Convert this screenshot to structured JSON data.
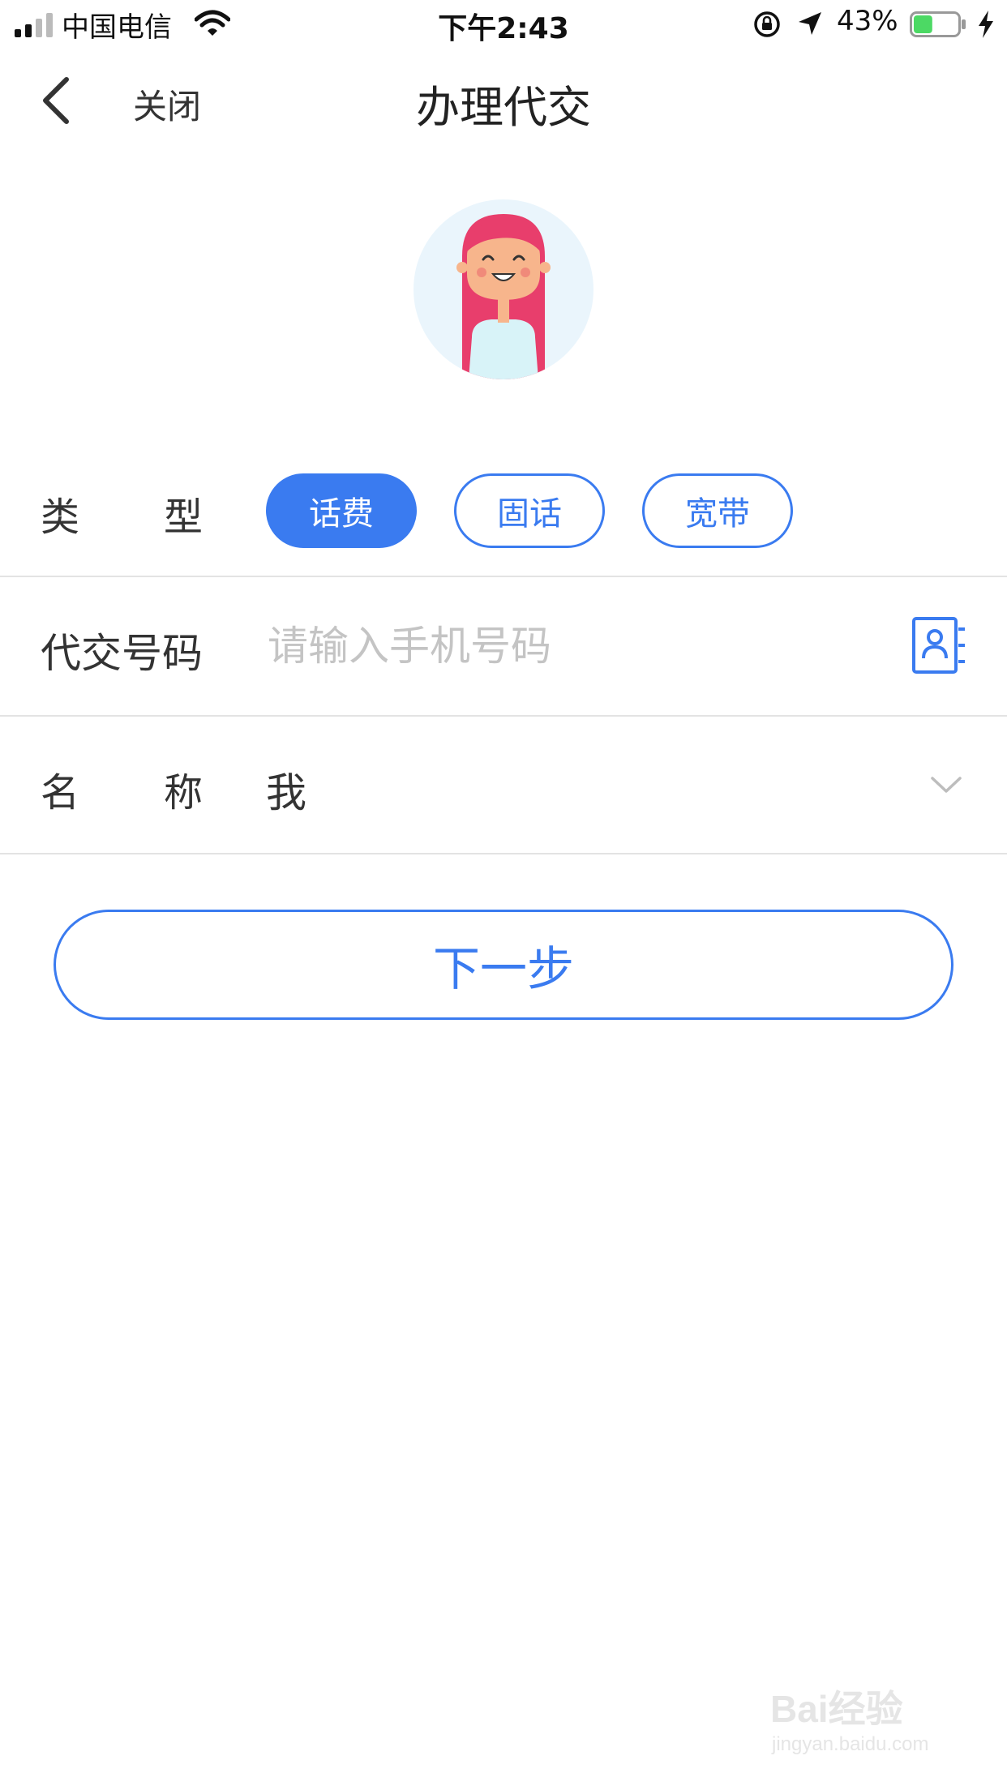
{
  "status_bar": {
    "carrier": "中国电信",
    "time": "下午2:43",
    "battery_percent": "43%",
    "battery_level": 0.43,
    "battery_color": "#4cd964"
  },
  "nav": {
    "close_label": "关闭",
    "title": "办理代交"
  },
  "type_row": {
    "label_chars": [
      "类",
      "型"
    ],
    "options": [
      {
        "label": "话费",
        "selected": true
      },
      {
        "label": "固话",
        "selected": false
      },
      {
        "label": "宽带",
        "selected": false
      }
    ]
  },
  "number_row": {
    "label": "代交号码",
    "placeholder": "请输入手机号码",
    "value": ""
  },
  "name_row": {
    "label_chars": [
      "名",
      "称"
    ],
    "value": "我"
  },
  "next_button": {
    "label": "下一步"
  },
  "watermark": {
    "logo_text": "Bai经验",
    "url": "jingyan.baidu.com"
  },
  "colors": {
    "accent": "#3a7bf0",
    "placeholder": "#c4c4c4",
    "divider": "#e3e3e3"
  },
  "icons": {
    "back": "chevron-left-icon",
    "contacts": "address-book-icon",
    "dropdown": "chevron-down-icon"
  }
}
